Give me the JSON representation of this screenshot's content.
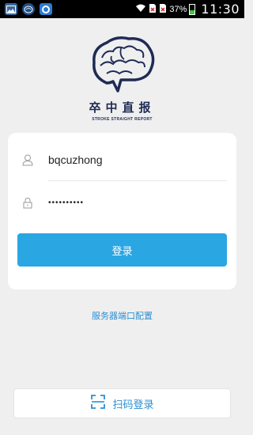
{
  "status_bar": {
    "battery_percent": "37%",
    "time": "11:30",
    "icons": [
      "gallery-icon",
      "brain-app-icon",
      "chat-app-icon",
      "wifi-icon",
      "no-sim-icon",
      "no-sim-icon",
      "battery-icon"
    ]
  },
  "brand": {
    "name_cn": "卒中直报",
    "name_en": "STROKE STRAIGHT REPORT",
    "color": "#1f2b55"
  },
  "login": {
    "username": "bqcuzhong",
    "password_mask": "••••••••••",
    "submit_label": "登录"
  },
  "server_config_label": "服务器端口配置",
  "scan_login_label": "扫码登录",
  "colors": {
    "accent": "#2aa6e3",
    "link": "#2a8fd4",
    "background": "#efefef"
  }
}
